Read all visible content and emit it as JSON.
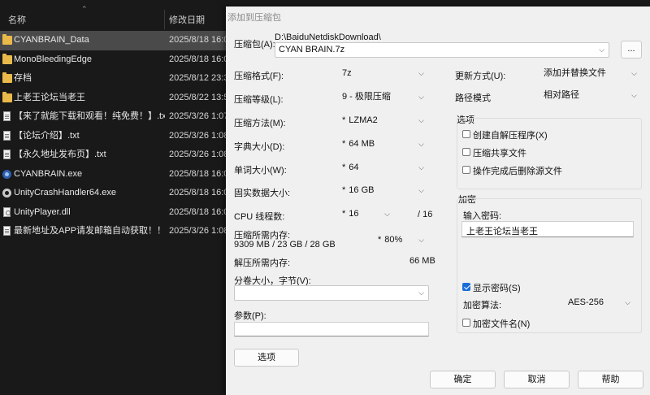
{
  "explorer": {
    "col_name": "名称",
    "col_date": "修改日期",
    "files": [
      {
        "name": "CYANBRAIN_Data",
        "date": "2025/8/18 16:0",
        "icon": "folder-icon",
        "selected": true
      },
      {
        "name": "MonoBleedingEdge",
        "date": "2025/8/18 16:0",
        "icon": "folder-icon"
      },
      {
        "name": "存档",
        "date": "2025/8/12 23:3",
        "icon": "folder-icon"
      },
      {
        "name": "上老王论坛当老王",
        "date": "2025/8/22 13:5",
        "icon": "folder-icon"
      },
      {
        "name": "【来了就能下载和观看！纯免费！】.txt",
        "date": "2025/3/26 1:07",
        "icon": "text-file-icon"
      },
      {
        "name": "【论坛介绍】.txt",
        "date": "2025/3/26 1:08",
        "icon": "text-file-icon"
      },
      {
        "name": "【永久地址发布页】.txt",
        "date": "2025/3/26 1:08",
        "icon": "text-file-icon"
      },
      {
        "name": "CYANBRAIN.exe",
        "date": "2025/8/18 16:0",
        "icon": "app-icon"
      },
      {
        "name": "UnityCrashHandler64.exe",
        "date": "2025/8/18 16:0",
        "icon": "gear-icon"
      },
      {
        "name": "UnityPlayer.dll",
        "date": "2025/8/18 16:0",
        "icon": "dll-file-icon"
      },
      {
        "name": "最新地址及APP请发邮箱自动获取！！！...",
        "date": "2025/3/26 1:08",
        "icon": "text-file-icon"
      }
    ]
  },
  "dialog": {
    "title": "添加到压缩包",
    "archive_label": "压缩包(A):",
    "archive_path": "D:\\BaiduNetdiskDownload\\",
    "archive_name": "CYAN BRAIN.7z",
    "browse": "...",
    "format_label": "压缩格式(F):",
    "format_value": "7z",
    "level_label": "压缩等级(L):",
    "level_value": "9 - 极限压缩",
    "method_label": "压缩方法(M):",
    "method_value": "LZMA2",
    "dict_label": "字典大小(D):",
    "dict_value": "64 MB",
    "word_label": "单词大小(W):",
    "word_value": "64",
    "solid_label": "固实数据大小:",
    "solid_value": "16 GB",
    "cpu_label": "CPU 线程数:",
    "cpu_value": "16",
    "cpu_total": "/ 16",
    "mem_label": "压缩所需内存:",
    "mem_detail": "9309 MB / 23 GB / 28 GB",
    "mem_value": "80%",
    "dmem_label": "解压所需内存:",
    "dmem_value": "66 MB",
    "split_label": "分卷大小，字节(V):",
    "split_value": "",
    "params_label": "参数(P):",
    "params_value": "",
    "options_button": "选项",
    "update_label": "更新方式(U):",
    "update_value": "添加并替换文件",
    "path_label": "路径模式",
    "path_value": "相对路径",
    "options_group": "选项",
    "opt_sfx": "创建自解压程序(X)",
    "opt_shared": "压缩共享文件",
    "opt_delete": "操作完成后删除源文件",
    "enc_group": "加密",
    "pwd_label": "输入密码:",
    "pwd_value": "上老王论坛当老王",
    "show_pwd": "显示密码(S)",
    "enc_method_label": "加密算法:",
    "enc_method_value": "AES-256",
    "enc_names": "加密文件名(N)",
    "ok": "确定",
    "cancel": "取消",
    "help": "帮助"
  },
  "colors": {
    "explorer_bg": "#191919",
    "selected_row": "#4a4a4a",
    "dialog_bg": "#f0f0f0",
    "accent": "#1a6ed8",
    "folder": "#e9b94a"
  }
}
